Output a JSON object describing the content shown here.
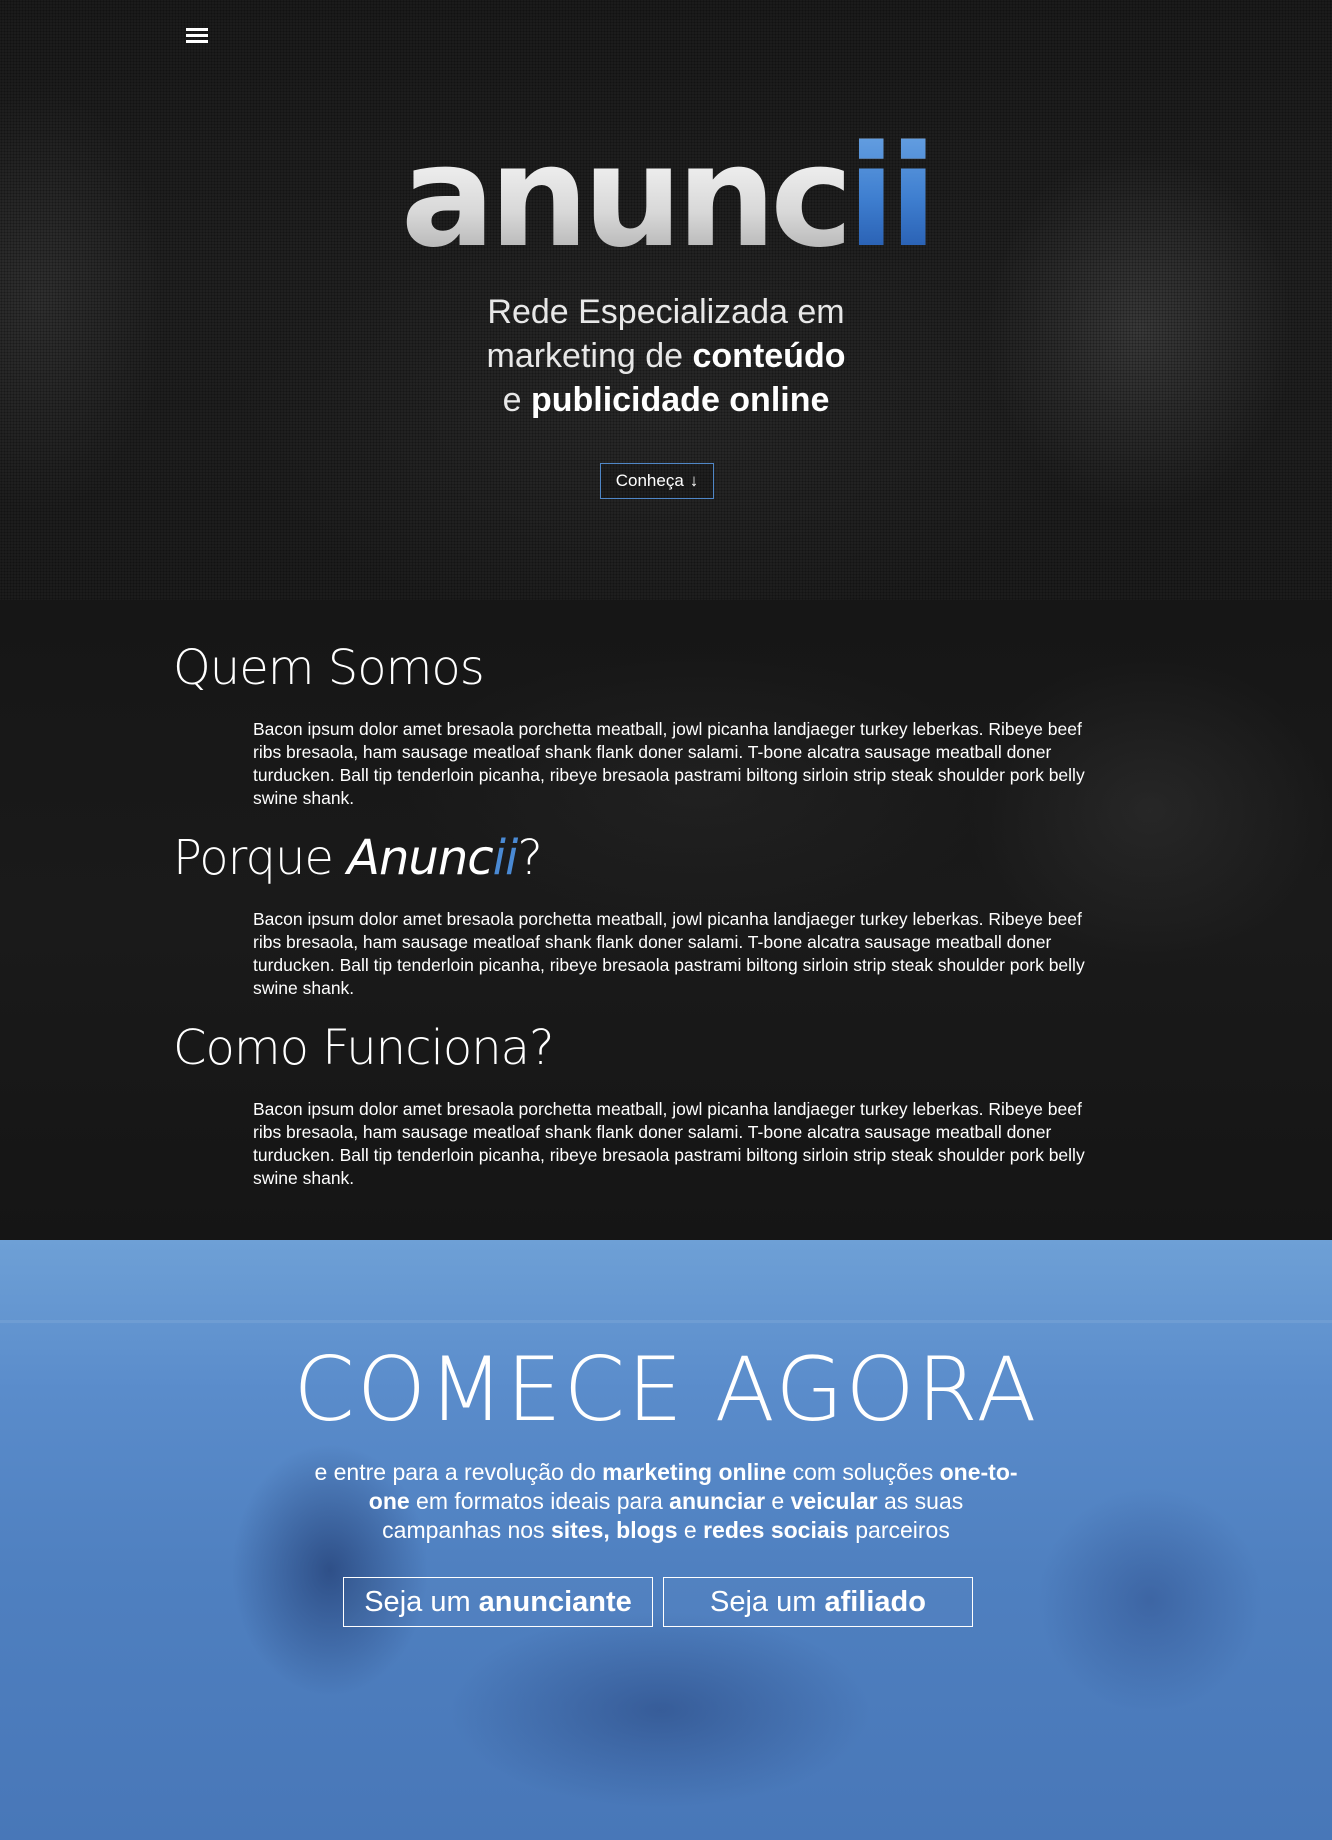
{
  "hero": {
    "logo_main": "anunc",
    "logo_accent": "ii",
    "tagline": {
      "line1": "Rede Especializada em",
      "line2_pre": "marketing de ",
      "line2_bold": "conteúdo",
      "line3_pre": "e ",
      "line3_bold": "publicidade online"
    },
    "cta_label": "Conheça",
    "cta_arrow": "↓",
    "menu_icon": "hamburger-icon"
  },
  "about": {
    "quem_somos": {
      "title": "Quem Somos",
      "text": "Bacon ipsum dolor amet bresaola porchetta meatball, jowl picanha landjaeger turkey leberkas. Ribeye beef ribs bresaola, ham sausage meatloaf shank flank doner salami. T-bone alcatra sausage meatball doner turducken. Ball tip tenderloin picanha, ribeye bresaola pastrami biltong sirloin strip steak shoulder pork belly swine shank."
    },
    "porque": {
      "title_pre": "Porque ",
      "title_brand": "Anunc",
      "title_brand_accent": "ii",
      "title_post": "?",
      "text": "Bacon ipsum dolor amet bresaola porchetta meatball, jowl picanha landjaeger turkey leberkas. Ribeye beef ribs bresaola, ham sausage meatloaf shank flank doner salami. T-bone alcatra sausage meatball doner turducken. Ball tip tenderloin picanha, ribeye bresaola pastrami biltong sirloin strip steak shoulder pork belly swine shank."
    },
    "como_funciona": {
      "title": "Como Funciona?",
      "text": "Bacon ipsum dolor amet bresaola porchetta meatball, jowl picanha landjaeger turkey leberkas. Ribeye beef ribs bresaola, ham sausage meatloaf shank flank doner salami. T-bone alcatra sausage meatball doner turducken. Ball tip tenderloin picanha, ribeye bresaola pastrami biltong sirloin strip steak shoulder pork belly swine shank."
    }
  },
  "cta": {
    "title": "COMECE AGORA",
    "text": {
      "p1": "e entre para a revolução do ",
      "b1": "marketing online",
      "p2": " com soluções ",
      "b2": "one-to-one",
      "p3": " em formatos ideais para ",
      "b3": "anunciar",
      "p4": " e ",
      "b4": "veicular",
      "p5": " as suas campanhas nos ",
      "b5": "sites, blogs",
      "p6": " e ",
      "b6": "redes sociais",
      "p7": " parceiros"
    },
    "advertiser_pre": "Seja um ",
    "advertiser_bold": "anunciante",
    "affiliate_pre": "Seja um ",
    "affiliate_bold": "afiliado"
  },
  "colors": {
    "accent_blue": "#4a8ad4",
    "dark_bg": "#151515",
    "cta_bg": "#5a8ccb"
  }
}
